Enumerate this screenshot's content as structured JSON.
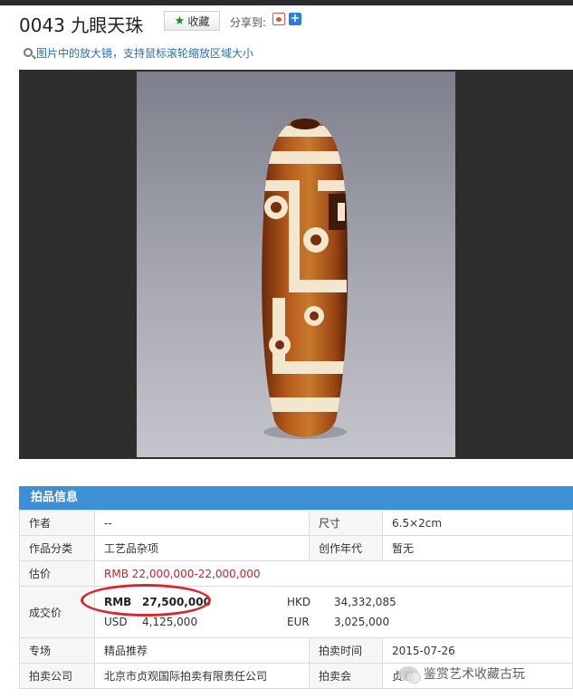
{
  "header": {
    "lot_title": "0043  九眼天珠",
    "favorite_label": "收藏",
    "share_label": "分享到:"
  },
  "hint": {
    "text": "图片中的放大镜，支持鼠标滚轮缩放区域大小"
  },
  "info": {
    "header": "拍品信息",
    "rows": {
      "author_label": "作者",
      "author_value": "--",
      "size_label": "尺寸",
      "size_value": "6.5×2cm",
      "category_label": "作品分类",
      "category_value": "工艺品杂项",
      "era_label": "创作年代",
      "era_value": "暂无",
      "estimate_label": "估价",
      "estimate_value": "RMB   22,000,000-22,000,000",
      "deal_label": "成交价",
      "deal": {
        "rmb_currency": "RMB",
        "rmb_value": "27,500,000",
        "hkd_currency": "HKD",
        "hkd_value": "34,332,085",
        "usd_currency": "USD",
        "usd_value": "4,125,000",
        "eur_currency": "EUR",
        "eur_value": "3,025,000"
      },
      "session_label": "专场",
      "session_value": "精品推荐",
      "auction_time_label": "拍卖时间",
      "auction_time_value": "2015-07-26",
      "company_label": "拍卖公司",
      "company_value": "北京市贞观国际拍卖有限责任公司",
      "auction_label": "拍卖会",
      "auction_value": "贞观"
    }
  },
  "watermark": {
    "text": "鉴赏艺术收藏古玩"
  },
  "colors": {
    "section_header": "#3d8fd6",
    "highlight_red": "#c8232a",
    "viewer_bg": "#2e2e2e"
  },
  "icons": [
    "star-icon",
    "weibo-share-icon",
    "add-share-icon",
    "magnifier-icon",
    "wechat-icon"
  ]
}
